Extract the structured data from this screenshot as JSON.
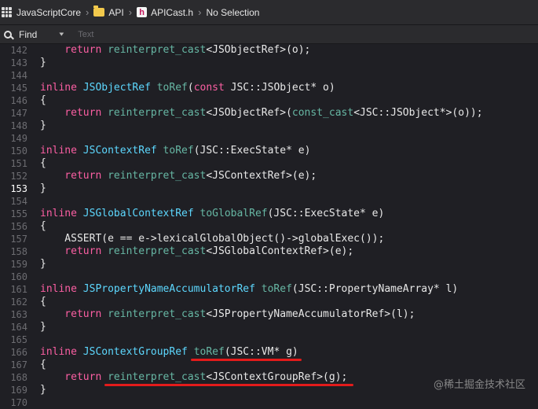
{
  "breadcrumb": {
    "project": "JavaScriptCore",
    "group": "API",
    "file": "APICast.h",
    "symbol": "No Selection",
    "file_badge": "h"
  },
  "find": {
    "label": "Find",
    "placeholder": "Text"
  },
  "editor": {
    "current_line": 153,
    "lines": [
      {
        "n": "142",
        "t": [
          [
            "kw",
            "    return "
          ],
          [
            "fn",
            "reinterpret_cast"
          ],
          [
            "pl",
            "<JSObjectRef>(o);"
          ]
        ]
      },
      {
        "n": "143",
        "t": [
          [
            "pl",
            "}"
          ]
        ]
      },
      {
        "n": "144",
        "t": []
      },
      {
        "n": "145",
        "t": [
          [
            "kw",
            "inline "
          ],
          [
            "ty",
            "JSObjectRef "
          ],
          [
            "fn",
            "toRef"
          ],
          [
            "pl",
            "("
          ],
          [
            "kw",
            "const "
          ],
          [
            "pl",
            "JSC::JSObject* o)"
          ]
        ]
      },
      {
        "n": "146",
        "t": [
          [
            "pl",
            "{"
          ]
        ]
      },
      {
        "n": "147",
        "t": [
          [
            "kw",
            "    return "
          ],
          [
            "fn",
            "reinterpret_cast"
          ],
          [
            "pl",
            "<JSObjectRef>("
          ],
          [
            "fn",
            "const_cast"
          ],
          [
            "pl",
            "<JSC::JSObject*>(o));"
          ]
        ]
      },
      {
        "n": "148",
        "t": [
          [
            "pl",
            "}"
          ]
        ]
      },
      {
        "n": "149",
        "t": []
      },
      {
        "n": "150",
        "t": [
          [
            "kw",
            "inline "
          ],
          [
            "ty",
            "JSContextRef "
          ],
          [
            "fn",
            "toRef"
          ],
          [
            "pl",
            "(JSC::ExecState* e)"
          ]
        ]
      },
      {
        "n": "151",
        "t": [
          [
            "pl",
            "{"
          ]
        ]
      },
      {
        "n": "152",
        "t": [
          [
            "kw",
            "    return "
          ],
          [
            "fn",
            "reinterpret_cast"
          ],
          [
            "pl",
            "<JSContextRef>(e);"
          ]
        ]
      },
      {
        "n": "153",
        "t": [
          [
            "pl",
            "}"
          ]
        ]
      },
      {
        "n": "154",
        "t": []
      },
      {
        "n": "155",
        "t": [
          [
            "kw",
            "inline "
          ],
          [
            "ty",
            "JSGlobalContextRef "
          ],
          [
            "fn",
            "toGlobalRef"
          ],
          [
            "pl",
            "(JSC::ExecState* e)"
          ]
        ]
      },
      {
        "n": "156",
        "t": [
          [
            "pl",
            "{"
          ]
        ]
      },
      {
        "n": "157",
        "t": [
          [
            "pl",
            "    ASSERT(e == e->lexicalGlobalObject()->globalExec());"
          ]
        ]
      },
      {
        "n": "158",
        "t": [
          [
            "kw",
            "    return "
          ],
          [
            "fn",
            "reinterpret_cast"
          ],
          [
            "pl",
            "<JSGlobalContextRef>(e);"
          ]
        ]
      },
      {
        "n": "159",
        "t": [
          [
            "pl",
            "}"
          ]
        ]
      },
      {
        "n": "160",
        "t": []
      },
      {
        "n": "161",
        "t": [
          [
            "kw",
            "inline "
          ],
          [
            "ty",
            "JSPropertyNameAccumulatorRef "
          ],
          [
            "fn",
            "toRef"
          ],
          [
            "pl",
            "(JSC::PropertyNameArray* l)"
          ]
        ]
      },
      {
        "n": "162",
        "t": [
          [
            "pl",
            "{"
          ]
        ]
      },
      {
        "n": "163",
        "t": [
          [
            "kw",
            "    return "
          ],
          [
            "fn",
            "reinterpret_cast"
          ],
          [
            "pl",
            "<JSPropertyNameAccumulatorRef>(l);"
          ]
        ]
      },
      {
        "n": "164",
        "t": [
          [
            "pl",
            "}"
          ]
        ]
      },
      {
        "n": "165",
        "t": []
      },
      {
        "n": "166",
        "t": [
          [
            "kw",
            "inline "
          ],
          [
            "ty",
            "JSContextGroupRef "
          ],
          [
            "fn",
            "toRef"
          ],
          [
            "pl",
            "(JSC::VM* g)"
          ]
        ]
      },
      {
        "n": "167",
        "t": [
          [
            "pl",
            "{"
          ]
        ]
      },
      {
        "n": "168",
        "t": [
          [
            "kw",
            "    return "
          ],
          [
            "fn",
            "reinterpret_cast"
          ],
          [
            "pl",
            "<JSContextGroupRef>(g);"
          ]
        ]
      },
      {
        "n": "169",
        "t": [
          [
            "pl",
            "}"
          ]
        ]
      },
      {
        "n": "170",
        "t": []
      }
    ]
  },
  "watermark": "@稀土掘金技术社区",
  "colors": {
    "keyword": "#fc5fa3",
    "type": "#5dd8ff",
    "function": "#67b7a4",
    "plain": "#e8e8e8",
    "annotation": "#e31b1b"
  }
}
